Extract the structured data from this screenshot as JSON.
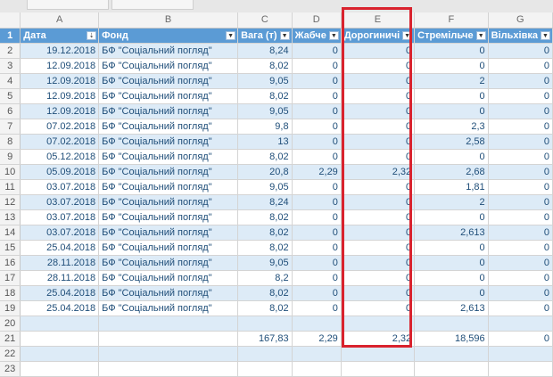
{
  "columns": [
    "A",
    "B",
    "C",
    "D",
    "E",
    "F",
    "G"
  ],
  "headers": [
    "Дата",
    "Фонд",
    "Вага (т)",
    "Жабче",
    "Дорогиничі",
    "Стремільче",
    "Вільхівка"
  ],
  "rows": [
    {
      "n": "2",
      "v": [
        "19.12.2018",
        "БФ \"Соціальний погляд\"",
        "8,24",
        "0",
        "0",
        "0",
        "0"
      ]
    },
    {
      "n": "3",
      "v": [
        "12.09.2018",
        "БФ \"Соціальний погляд\"",
        "8,02",
        "0",
        "0",
        "0",
        "0"
      ]
    },
    {
      "n": "4",
      "v": [
        "12.09.2018",
        "БФ \"Соціальний погляд\"",
        "9,05",
        "0",
        "0",
        "2",
        "0"
      ]
    },
    {
      "n": "5",
      "v": [
        "12.09.2018",
        "БФ \"Соціальний погляд\"",
        "8,02",
        "0",
        "0",
        "0",
        "0"
      ]
    },
    {
      "n": "6",
      "v": [
        "12.09.2018",
        "БФ \"Соціальний погляд\"",
        "9,05",
        "0",
        "0",
        "0",
        "0"
      ]
    },
    {
      "n": "7",
      "v": [
        "07.02.2018",
        "БФ \"Соціальний погляд\"",
        "9,8",
        "0",
        "0",
        "2,3",
        "0"
      ]
    },
    {
      "n": "8",
      "v": [
        "07.02.2018",
        "БФ \"Соціальний погляд\"",
        "13",
        "0",
        "0",
        "2,58",
        "0"
      ]
    },
    {
      "n": "9",
      "v": [
        "05.12.2018",
        "БФ \"Соціальний погляд\"",
        "8,02",
        "0",
        "0",
        "0",
        "0"
      ]
    },
    {
      "n": "10",
      "v": [
        "05.09.2018",
        "БФ \"Соціальний погляд\"",
        "20,8",
        "2,29",
        "2,32",
        "2,68",
        "0"
      ]
    },
    {
      "n": "11",
      "v": [
        "03.07.2018",
        "БФ \"Соціальний погляд\"",
        "9,05",
        "0",
        "0",
        "1,81",
        "0"
      ]
    },
    {
      "n": "12",
      "v": [
        "03.07.2018",
        "БФ \"Соціальний погляд\"",
        "8,24",
        "0",
        "0",
        "2",
        "0"
      ]
    },
    {
      "n": "13",
      "v": [
        "03.07.2018",
        "БФ \"Соціальний погляд\"",
        "8,02",
        "0",
        "0",
        "0",
        "0"
      ]
    },
    {
      "n": "14",
      "v": [
        "03.07.2018",
        "БФ \"Соціальний погляд\"",
        "8,02",
        "0",
        "0",
        "2,613",
        "0"
      ]
    },
    {
      "n": "15",
      "v": [
        "25.04.2018",
        "БФ \"Соціальний погляд\"",
        "8,02",
        "0",
        "0",
        "0",
        "0"
      ]
    },
    {
      "n": "16",
      "v": [
        "28.11.2018",
        "БФ \"Соціальний погляд\"",
        "9,05",
        "0",
        "0",
        "0",
        "0"
      ]
    },
    {
      "n": "17",
      "v": [
        "28.11.2018",
        "БФ \"Соціальний погляд\"",
        "8,2",
        "0",
        "0",
        "0",
        "0"
      ]
    },
    {
      "n": "18",
      "v": [
        "25.04.2018",
        "БФ \"Соціальний погляд\"",
        "8,02",
        "0",
        "0",
        "0",
        "0"
      ]
    },
    {
      "n": "19",
      "v": [
        "25.04.2018",
        "БФ \"Соціальний погляд\"",
        "8,02",
        "0",
        "0",
        "2,613",
        "0"
      ]
    },
    {
      "n": "20",
      "v": [
        "",
        "",
        "",
        "",
        "",
        "",
        ""
      ]
    },
    {
      "n": "21",
      "v": [
        "",
        "",
        "167,83",
        "2,29",
        "2,32",
        "18,596",
        "0"
      ]
    },
    {
      "n": "22",
      "v": [
        "",
        "",
        "",
        "",
        "",
        "",
        ""
      ]
    },
    {
      "n": "23",
      "v": [
        "",
        "",
        "",
        "",
        "",
        "",
        ""
      ]
    }
  ],
  "colors": {
    "highlight": "#d9232e",
    "band": "#ddebf7",
    "header": "#5b9bd5"
  }
}
